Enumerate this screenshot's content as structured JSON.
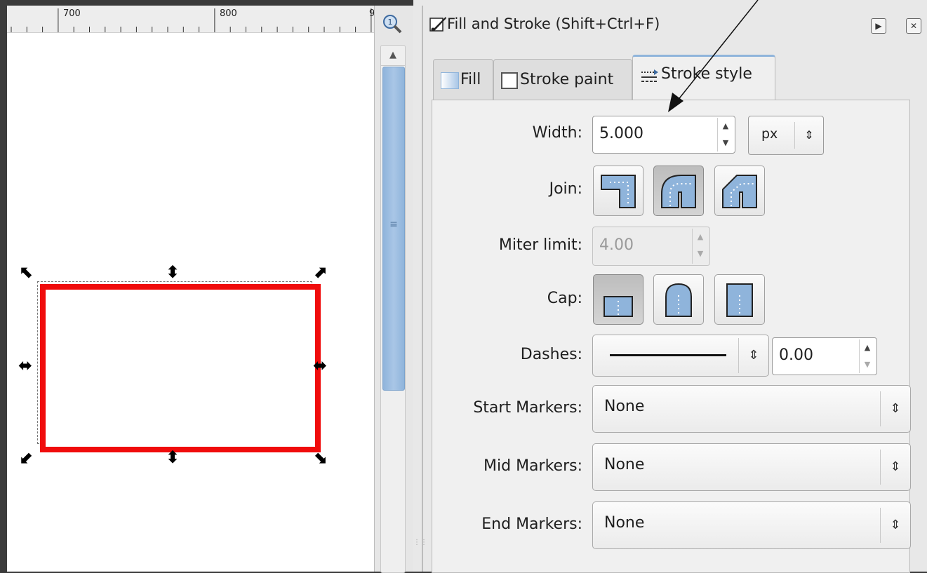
{
  "ruler": {
    "labels": [
      "700",
      "800",
      "9"
    ]
  },
  "dialog": {
    "title": "Fill and Stroke (Shift+Ctrl+F)",
    "title_icon": "pen-brush-icon",
    "buttons": {
      "collapse_icon": "play-icon",
      "close_icon": "close-icon",
      "collapse_glyph": "▶",
      "close_glyph": "✕"
    }
  },
  "tabs": [
    {
      "label": "Fill",
      "icon": "fill-swatch-icon",
      "active": false
    },
    {
      "label": "Stroke paint",
      "icon": "stroke-paint-icon",
      "active": false
    },
    {
      "label": "Stroke style",
      "icon": "stroke-style-icon",
      "active": true
    }
  ],
  "stroke_style": {
    "width": {
      "label": "Width:",
      "value": "5.000",
      "unit": "px"
    },
    "join": {
      "label": "Join:",
      "options": [
        "miter-join",
        "round-join",
        "bevel-join"
      ],
      "selected": "round-join"
    },
    "miter_limit": {
      "label": "Miter limit:",
      "value": "4.00",
      "disabled": true
    },
    "cap": {
      "label": "Cap:",
      "options": [
        "butt-cap",
        "round-cap",
        "square-cap"
      ],
      "selected": "butt-cap"
    },
    "dashes": {
      "label": "Dashes:",
      "pattern": "solid",
      "offset": "0.00"
    },
    "start_markers": {
      "label": "Start Markers:",
      "value": "None"
    },
    "mid_markers": {
      "label": "Mid Markers:",
      "value": "None"
    },
    "end_markers": {
      "label": "End Markers:",
      "value": "None"
    }
  },
  "canvas": {
    "stroke_color": "#f00c0c",
    "selection": "rectangle"
  },
  "colors": {
    "accent": "#8fb4db",
    "panel_bg": "#e8e8e8"
  }
}
